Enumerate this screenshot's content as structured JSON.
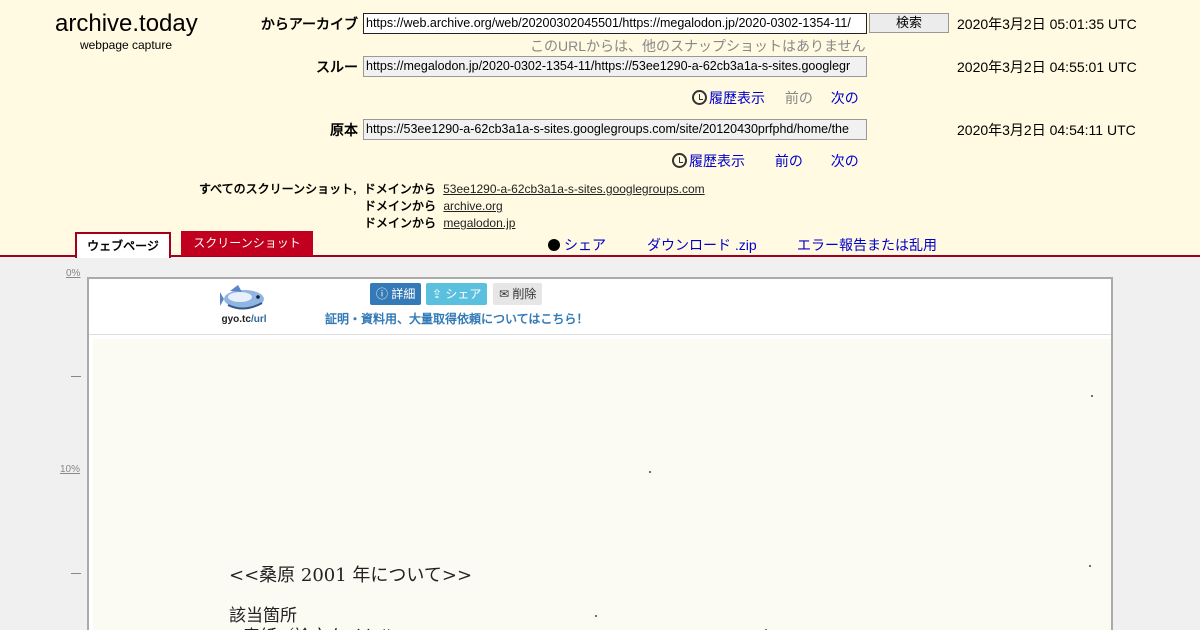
{
  "site": {
    "name": "archive.today",
    "tagline": "webpage capture"
  },
  "archive_row": {
    "label": "からアーカイブ",
    "url": "https://web.archive.org/web/20200302045501/https://megalodon.jp/2020-0302-1354-11/",
    "search_label": "検索",
    "timestamp": "2020年3月2日 05:01:35 UTC",
    "note": "このURLからは、他のスナップショットはありません"
  },
  "through_row": {
    "label": "スルー",
    "url": "https://megalodon.jp/2020-0302-1354-11/https://53ee1290-a-62cb3a1a-s-sites.googlegr",
    "timestamp": "2020年3月2日 04:55:01 UTC",
    "history": "履歴表示",
    "prev": "前の",
    "next": "次の"
  },
  "original_row": {
    "label": "原本",
    "url": "https://53ee1290-a-62cb3a1a-s-sites.googlegroups.com/site/20120430prfphd/home/the",
    "timestamp": "2020年3月2日 04:54:11 UTC",
    "history": "履歴表示",
    "prev": "前の",
    "next": "次の"
  },
  "domains": {
    "all_label": "すべてのスクリーンショット,",
    "from_label": "ドメインから",
    "items": [
      "53ee1290-a-62cb3a1a-s-sites.googlegroups.com",
      "archive.org",
      "megalodon.jp"
    ]
  },
  "tabs": {
    "webpage": "ウェブページ",
    "screenshot": "スクリーンショット"
  },
  "actions": {
    "share": "シェア",
    "download": "ダウンロード .zip",
    "report": "エラー報告または乱用"
  },
  "ruler": {
    "p0": "0%",
    "p10": "10%"
  },
  "capture": {
    "logo_text": "gyo.tc",
    "logo_suffix": "/url",
    "detail": "詳細",
    "share": "シェア",
    "delete": "削除",
    "cert_link": "証明・資料用、大量取得依頼についてはこちら！",
    "heading": "<<桑原 2001 年について>>",
    "line1": "該当箇所",
    "line2": "表紙／論文タイトル"
  },
  "colors": {
    "header_bg": "#fffae1",
    "accent": "#a0001e",
    "link": "#0000cc"
  }
}
